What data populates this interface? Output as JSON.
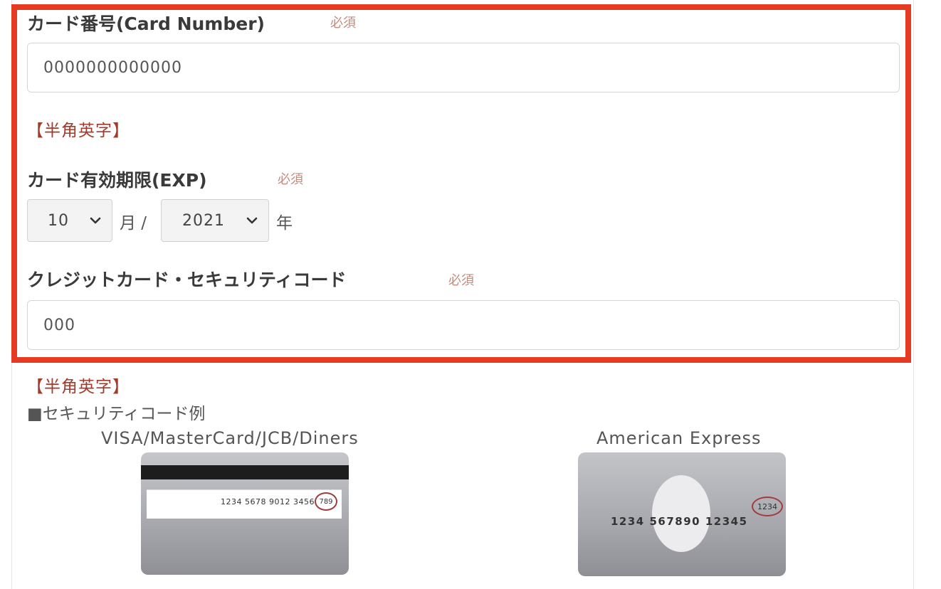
{
  "card_number": {
    "label": "カード番号(Card Number)",
    "required": "必須",
    "value": "0000000000000",
    "hint": "【半角英字】"
  },
  "expiry": {
    "label": "カード有効期限(EXP)",
    "required": "必須",
    "month_value": "10",
    "month_unit": "月 /",
    "year_value": "2021",
    "year_unit": "年"
  },
  "security_code": {
    "label": "クレジットカード・セキュリティコード",
    "required": "必須",
    "value": "000",
    "hint": "【半角英字】"
  },
  "examples": {
    "title": "■セキュリティコード例",
    "visa": {
      "name": "VISA/MasterCard/JCB/Diners",
      "number": "1234 5678 9012 3456",
      "cvv": "789"
    },
    "amex": {
      "name": "American Express",
      "number": "1234 567890 12345",
      "cid": "1234"
    }
  },
  "colors": {
    "highlight_border": "#e63b23",
    "required_text": "#c58a7e",
    "hint_text": "#a33a2a"
  }
}
